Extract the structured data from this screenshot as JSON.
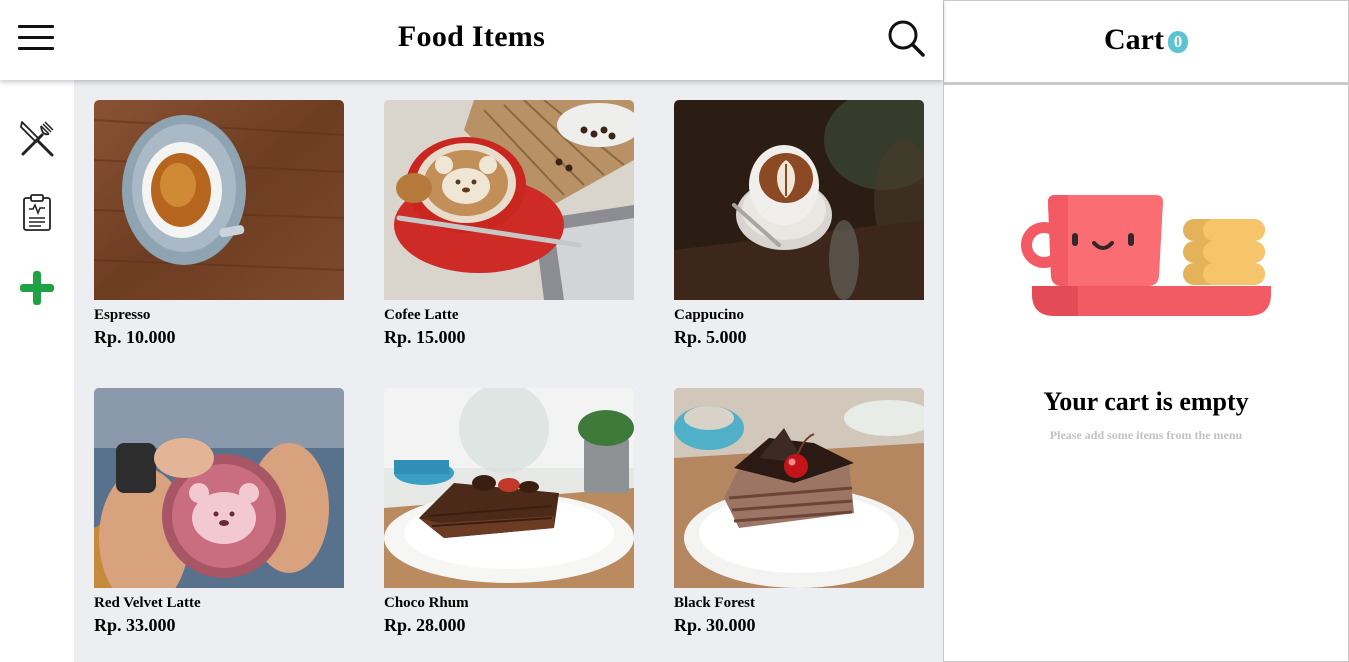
{
  "header": {
    "title": "Food Items",
    "menu_icon": "hamburger-menu-icon",
    "search_icon": "search-icon"
  },
  "sidebar": {
    "items": [
      {
        "icon": "utensils-icon"
      },
      {
        "icon": "clipboard-icon"
      },
      {
        "icon": "plus-icon",
        "color": "#1fa243"
      }
    ]
  },
  "menu_items": [
    {
      "name": "Espresso",
      "price": "Rp. 10.000"
    },
    {
      "name": "Cofee Latte",
      "price": "Rp. 15.000"
    },
    {
      "name": "Cappucino",
      "price": "Rp. 5.000"
    },
    {
      "name": "Red Velvet Latte",
      "price": "Rp. 33.000"
    },
    {
      "name": "Choco Rhum",
      "price": "Rp. 28.000"
    },
    {
      "name": "Black Forest",
      "price": "Rp. 30.000"
    }
  ],
  "cart": {
    "title": "Cart",
    "count": "0",
    "badge_color": "#5bc4d0",
    "empty_title": "Your cart is empty",
    "empty_subtitle": "Please add some items from the menu"
  }
}
